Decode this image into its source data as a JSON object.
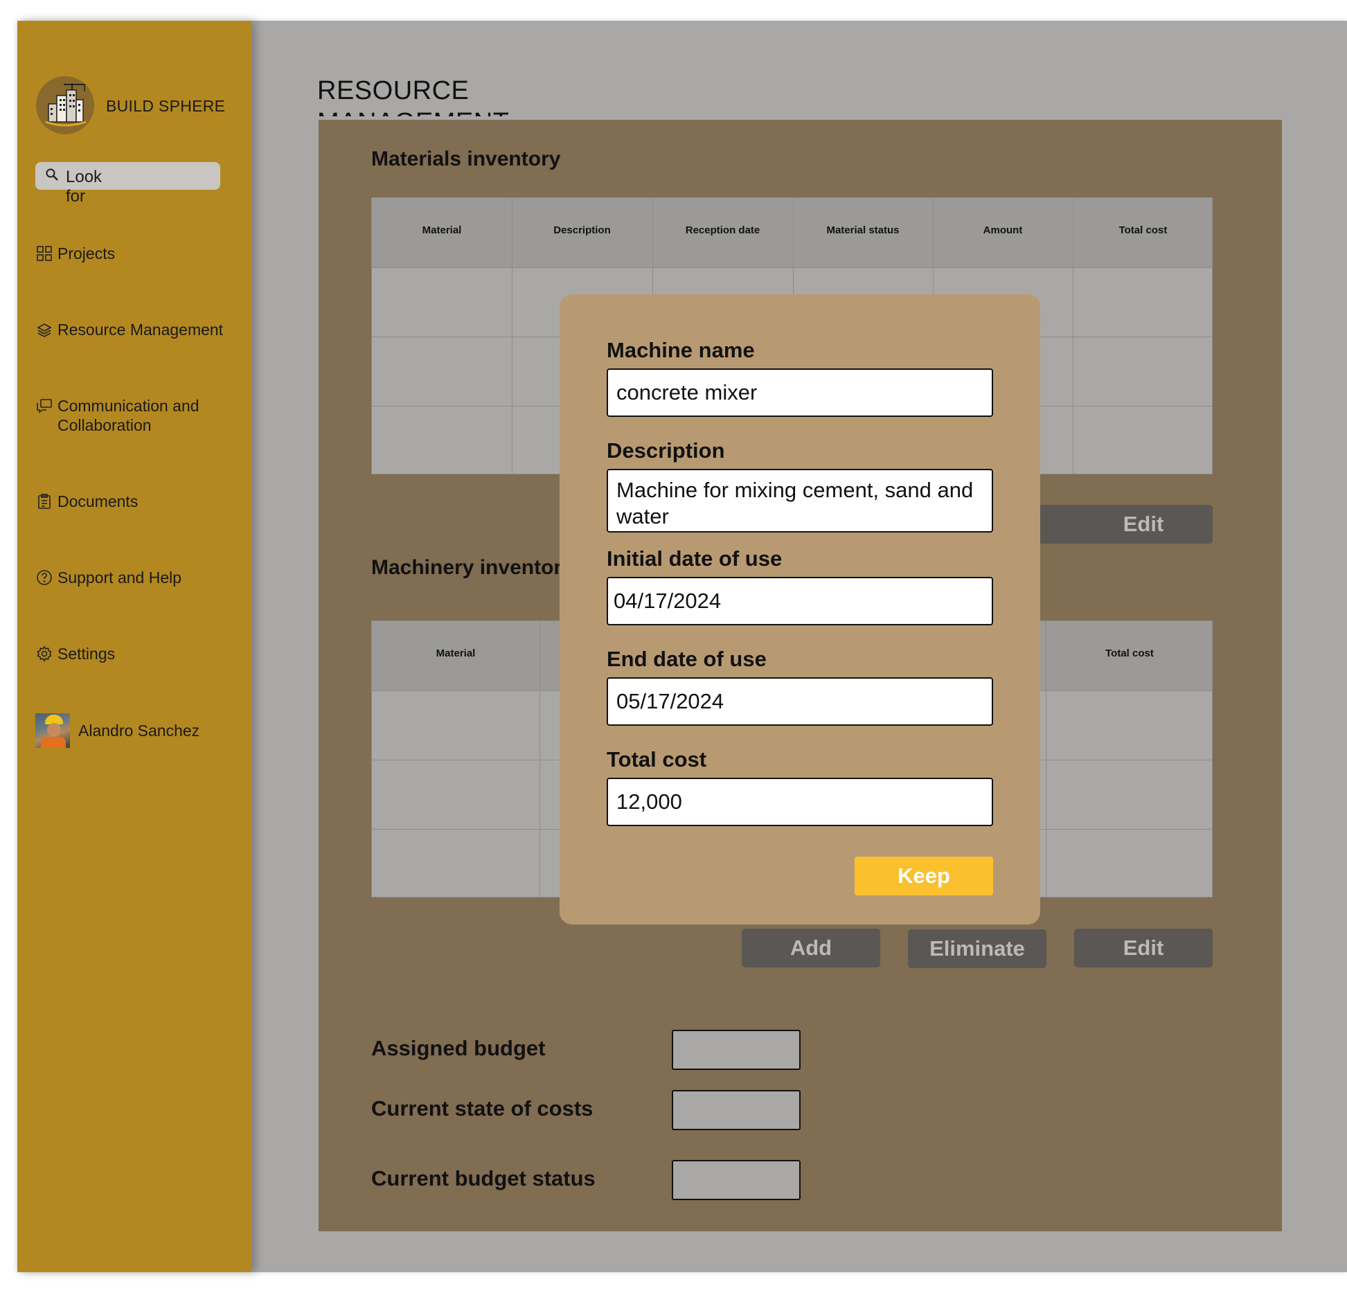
{
  "app": {
    "brand": "BUILD SPHERE"
  },
  "search": {
    "placeholder": "Look for"
  },
  "sidebar": {
    "items": [
      {
        "label": "Projects",
        "icon": "grid-icon"
      },
      {
        "label": "Resource Management",
        "icon": "layers-icon"
      },
      {
        "label": "Communication and Collaboration",
        "icon": "chat-icon"
      },
      {
        "label": "Documents",
        "icon": "clipboard-icon"
      },
      {
        "label": "Support and Help",
        "icon": "help-circle-icon"
      },
      {
        "label": "Settings",
        "icon": "gear-icon"
      }
    ],
    "user": {
      "name": "Alandro Sanchez"
    }
  },
  "page": {
    "title": "RESOURCE MANAGEMENT"
  },
  "materials": {
    "title": "Materials inventory",
    "columns": [
      "Material",
      "Description",
      "Reception date",
      "Material status",
      "Amount",
      "Total cost"
    ],
    "edit_label": "Edit"
  },
  "machinery": {
    "title": "Machinery inventory",
    "columns": [
      "Material",
      "Total cost"
    ],
    "add_label": "Add",
    "eliminate_label": "Eliminate",
    "edit_label": "Edit"
  },
  "budget": {
    "assigned_label": "Assigned budget",
    "current_costs_label": "Current state of costs",
    "status_label": "Current budget status"
  },
  "modal": {
    "machine_name_label": "Machine name",
    "machine_name_value": "concrete mixer",
    "description_label": "Description",
    "description_value": "Machine for mixing cement, sand and water",
    "start_date_label": "Initial date of use",
    "start_date_value": "04/17/2024",
    "end_date_label": "End date of use",
    "end_date_value": "05/17/2024",
    "total_cost_label": "Total cost",
    "total_cost_value": "12,000",
    "keep_label": "Keep"
  },
  "colors": {
    "sidebar": "#b38820",
    "backdrop": "#a9a8a6",
    "panel": "#806d52",
    "modal": "#b89a72",
    "button_dark": "#5a5754",
    "keep_button": "#fbc02d"
  }
}
